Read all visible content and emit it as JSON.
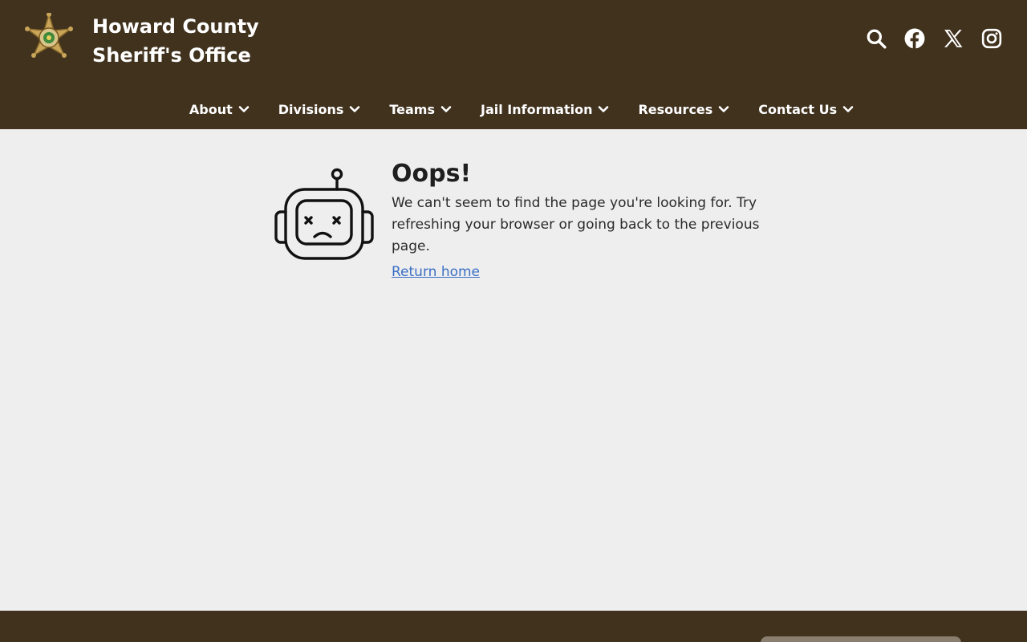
{
  "header": {
    "site_name_line1": "Howard County",
    "site_name_line2": "Sheriff's Office",
    "logo_icon": "sheriff-star-badge-icon",
    "background": "#41321e",
    "icons": [
      "search-icon",
      "facebook-icon",
      "x-twitter-icon",
      "instagram-icon"
    ]
  },
  "nav": {
    "items": [
      {
        "label": "About"
      },
      {
        "label": "Divisions"
      },
      {
        "label": "Teams"
      },
      {
        "label": "Jail Information"
      },
      {
        "label": "Resources"
      },
      {
        "label": "Contact Us"
      }
    ]
  },
  "error": {
    "icon": "sad-robot-icon",
    "title": "Oops!",
    "message": "We can't seem to find the page you're looking for. Try refreshing your browser or going back to the previous page.",
    "link_label": "Return home",
    "link_color": "#3a6fc4"
  },
  "colors": {
    "page_background": "#eeeeee",
    "footer_background": "#41321e"
  }
}
